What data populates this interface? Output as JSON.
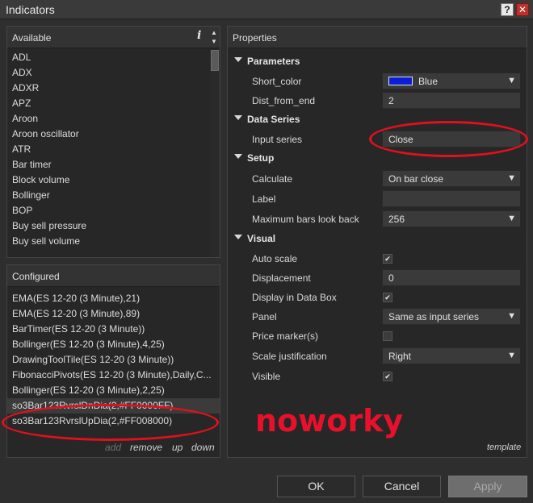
{
  "window": {
    "title": "Indicators",
    "help_glyph": "?",
    "close_glyph": "✕"
  },
  "available": {
    "header": "Available",
    "info_glyph": "i",
    "items": [
      "ADL",
      "ADX",
      "ADXR",
      "APZ",
      "Aroon",
      "Aroon oscillator",
      "ATR",
      "Bar timer",
      "Block volume",
      "Bollinger",
      "BOP",
      "Buy sell pressure",
      "Buy sell volume"
    ]
  },
  "configured": {
    "header": "Configured",
    "items": [
      "EMA(ES 12-20 (3 Minute),21)",
      "EMA(ES 12-20 (3 Minute),89)",
      "BarTimer(ES 12-20 (3 Minute))",
      "Bollinger(ES 12-20 (3 Minute),4,25)",
      "DrawingToolTile(ES 12-20 (3 Minute))",
      "FibonacciPivots(ES 12-20 (3 Minute),Daily,C...",
      "Bollinger(ES 12-20 (3 Minute),2,25)",
      "so3Bar123RvrslDnDia(2,#FF0000FF)",
      "so3Bar123RvrslUpDia(2,#FF008000)"
    ],
    "actions": {
      "add": "add",
      "remove": "remove",
      "up": "up",
      "down": "down"
    }
  },
  "properties": {
    "header": "Properties",
    "categories": {
      "parameters": "Parameters",
      "data_series": "Data Series",
      "setup": "Setup",
      "visual": "Visual"
    },
    "short_color": {
      "label": "Short_color",
      "value": "Blue",
      "swatch": "#0a1ed8"
    },
    "dist_from_end": {
      "label": "Dist_from_end",
      "value": "2"
    },
    "input_series": {
      "label": "Input series",
      "value": "Close"
    },
    "calculate": {
      "label": "Calculate",
      "value": "On bar close"
    },
    "label_field": {
      "label": "Label",
      "value": ""
    },
    "max_bars": {
      "label": "Maximum bars look back",
      "value": "256"
    },
    "auto_scale": {
      "label": "Auto scale",
      "checked": true
    },
    "displacement": {
      "label": "Displacement",
      "value": "0"
    },
    "display_in_data_box": {
      "label": "Display in Data Box",
      "checked": true
    },
    "panel": {
      "label": "Panel",
      "value": "Same as input series"
    },
    "price_marker": {
      "label": "Price marker(s)",
      "checked": false
    },
    "scale_justification": {
      "label": "Scale justification",
      "value": "Right"
    },
    "visible": {
      "label": "Visible",
      "checked": true
    },
    "template_link": "template"
  },
  "buttons": {
    "ok": "OK",
    "cancel": "Cancel",
    "apply": "Apply"
  },
  "annotation": {
    "text": "noworky",
    "color": "#e8102a"
  },
  "glyphs": {
    "checkmark": "✔",
    "dropdown": "▼"
  }
}
